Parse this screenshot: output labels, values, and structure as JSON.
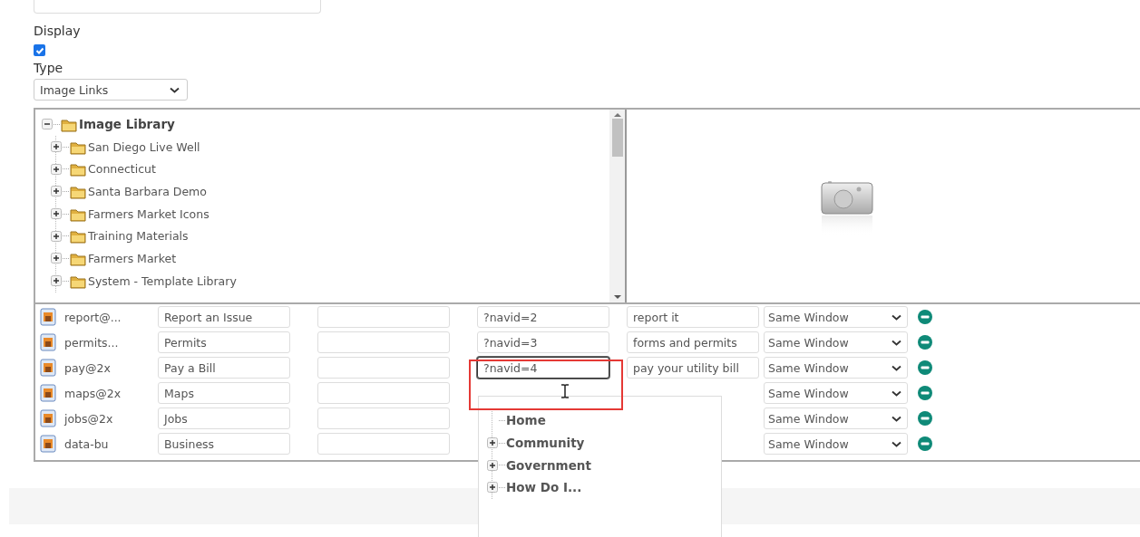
{
  "display": {
    "label": "Display",
    "checked": true
  },
  "type": {
    "label": "Type",
    "value": "Image Links"
  },
  "image_tree": {
    "label": "Image Library",
    "expanded": true,
    "children": [
      {
        "label": "San Diego Live Well",
        "expanded": false
      },
      {
        "label": "Connecticut",
        "expanded": false
      },
      {
        "label": "Santa Barbara Demo",
        "expanded": false
      },
      {
        "label": "Farmers Market Icons",
        "expanded": false
      },
      {
        "label": "Training Materials",
        "expanded": false
      },
      {
        "label": "Farmers Market",
        "expanded": false
      },
      {
        "label": "System - Template Library",
        "expanded": false
      }
    ]
  },
  "links": [
    {
      "name": "report@...",
      "title": "Report an Issue",
      "url": "?navid=2",
      "description": "report it",
      "target": "Same Window",
      "focused": false
    },
    {
      "name": "permits...",
      "title": "Permits",
      "url": "?navid=3",
      "description": "forms and permits",
      "target": "Same Window",
      "focused": false
    },
    {
      "name": "pay@2x",
      "title": "Pay a Bill",
      "url": "?navid=4",
      "description": "pay your utility bill",
      "target": "Same Window",
      "focused": true
    },
    {
      "name": "maps@2x",
      "title": "Maps",
      "target": "Same Window",
      "focused": false
    },
    {
      "name": "jobs@2x",
      "title": "Jobs",
      "target": "Same Window",
      "focused": false
    },
    {
      "name": "data-bu",
      "title": "Business",
      "target": "Same Window",
      "focused": false
    }
  ],
  "nav_dropdown": {
    "items": [
      {
        "label": "Home",
        "expandable": false
      },
      {
        "label": "Community",
        "expandable": true
      },
      {
        "label": "Government",
        "expandable": true
      },
      {
        "label": "How Do I...",
        "expandable": true
      }
    ]
  }
}
